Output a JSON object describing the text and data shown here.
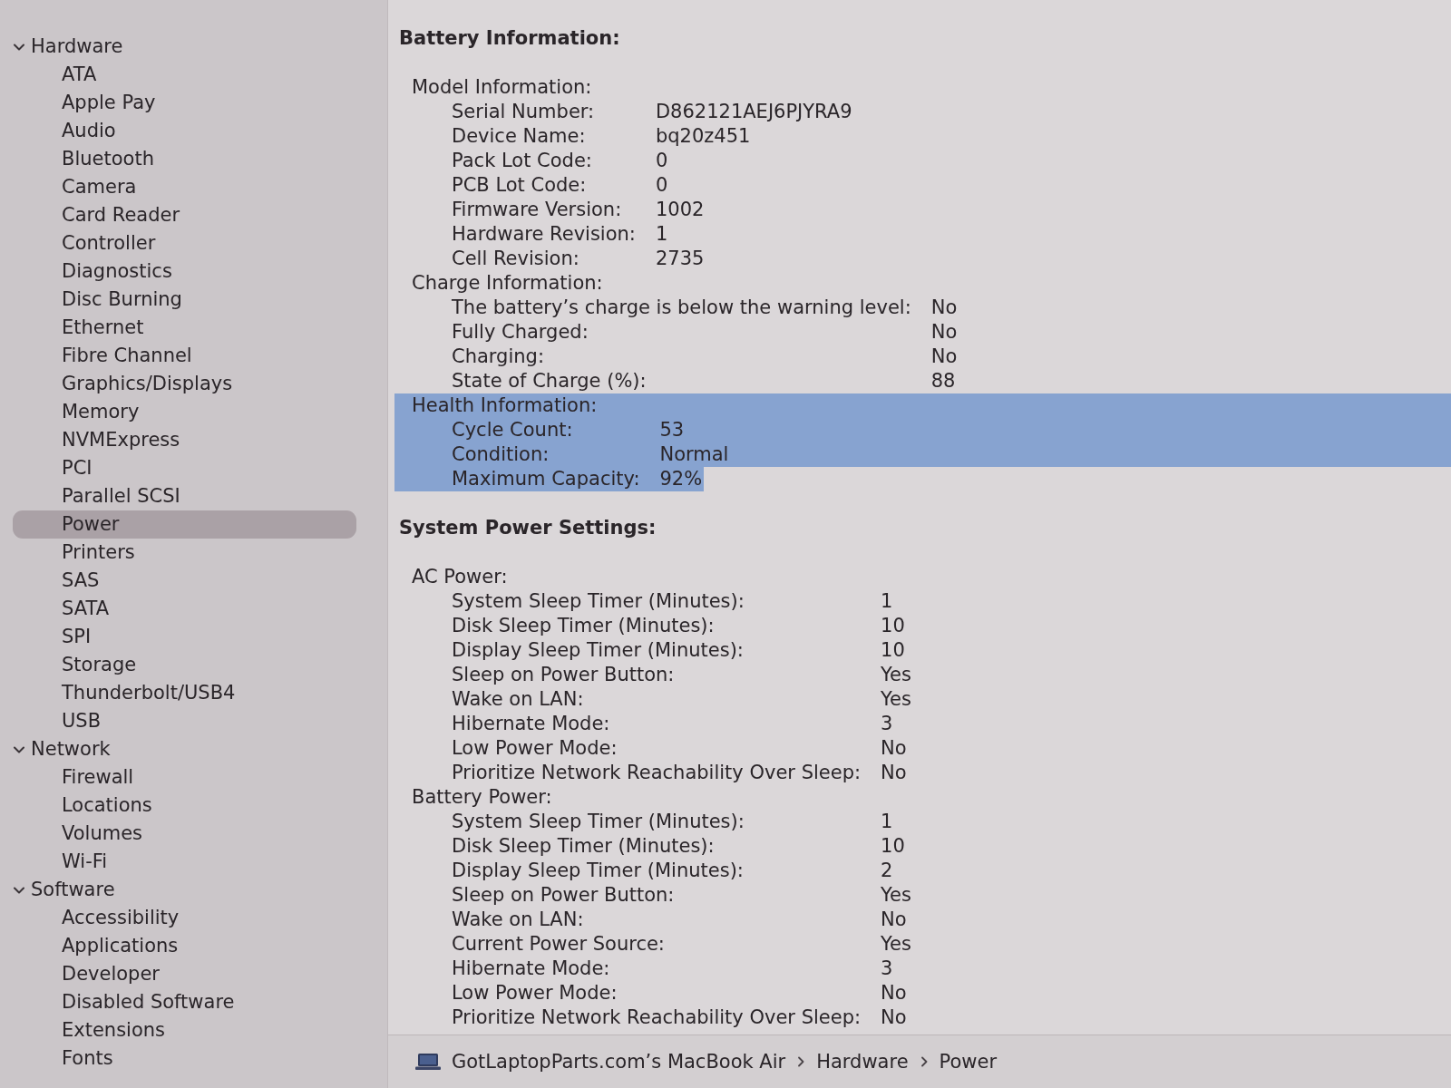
{
  "sidebar": {
    "items": [
      {
        "label": "Hardware",
        "expanded": true,
        "selected": false,
        "children": [
          {
            "label": "ATA",
            "selected": false
          },
          {
            "label": "Apple Pay",
            "selected": false
          },
          {
            "label": "Audio",
            "selected": false
          },
          {
            "label": "Bluetooth",
            "selected": false
          },
          {
            "label": "Camera",
            "selected": false
          },
          {
            "label": "Card Reader",
            "selected": false
          },
          {
            "label": "Controller",
            "selected": false
          },
          {
            "label": "Diagnostics",
            "selected": false
          },
          {
            "label": "Disc Burning",
            "selected": false
          },
          {
            "label": "Ethernet",
            "selected": false
          },
          {
            "label": "Fibre Channel",
            "selected": false
          },
          {
            "label": "Graphics/Displays",
            "selected": false
          },
          {
            "label": "Memory",
            "selected": false
          },
          {
            "label": "NVMExpress",
            "selected": false
          },
          {
            "label": "PCI",
            "selected": false
          },
          {
            "label": "Parallel SCSI",
            "selected": false
          },
          {
            "label": "Power",
            "selected": true
          },
          {
            "label": "Printers",
            "selected": false
          },
          {
            "label": "SAS",
            "selected": false
          },
          {
            "label": "SATA",
            "selected": false
          },
          {
            "label": "SPI",
            "selected": false
          },
          {
            "label": "Storage",
            "selected": false
          },
          {
            "label": "Thunderbolt/USB4",
            "selected": false
          },
          {
            "label": "USB",
            "selected": false
          }
        ]
      },
      {
        "label": "Network",
        "expanded": true,
        "selected": false,
        "children": [
          {
            "label": "Firewall",
            "selected": false
          },
          {
            "label": "Locations",
            "selected": false
          },
          {
            "label": "Volumes",
            "selected": false
          },
          {
            "label": "Wi-Fi",
            "selected": false
          }
        ]
      },
      {
        "label": "Software",
        "expanded": true,
        "selected": false,
        "children": [
          {
            "label": "Accessibility",
            "selected": false
          },
          {
            "label": "Applications",
            "selected": false
          },
          {
            "label": "Developer",
            "selected": false
          },
          {
            "label": "Disabled Software",
            "selected": false
          },
          {
            "label": "Extensions",
            "selected": false
          },
          {
            "label": "Fonts",
            "selected": false
          }
        ]
      }
    ]
  },
  "content": {
    "sections": [
      {
        "title": "Battery Information:",
        "groups": [
          {
            "title": "Model Information:",
            "selected": false,
            "rows": [
              {
                "label": "Serial Number:",
                "value": "D862121AEJ6PJYRA9",
                "selected": false
              },
              {
                "label": "Device Name:",
                "value": "bq20z451",
                "selected": false
              },
              {
                "label": "Pack Lot Code:",
                "value": "0",
                "selected": false
              },
              {
                "label": "PCB Lot Code:",
                "value": "0",
                "selected": false
              },
              {
                "label": "Firmware Version:",
                "value": "1002",
                "selected": false
              },
              {
                "label": "Hardware Revision:",
                "value": "1",
                "selected": false
              },
              {
                "label": "Cell Revision:",
                "value": "2735",
                "selected": false
              }
            ]
          },
          {
            "title": "Charge Information:",
            "selected": false,
            "rows": [
              {
                "label": "The battery’s charge is below the warning level:",
                "value": "No",
                "selected": false
              },
              {
                "label": "Fully Charged:",
                "value": "No",
                "selected": false
              },
              {
                "label": "Charging:",
                "value": "No",
                "selected": false
              },
              {
                "label": "State of Charge (%):",
                "value": "88",
                "selected": false
              }
            ]
          },
          {
            "title": "Health Information:",
            "selected": true,
            "rows": [
              {
                "label": "Cycle Count:",
                "value": "53",
                "selected": true
              },
              {
                "label": "Condition:",
                "value": "Normal",
                "selected": true
              },
              {
                "label": "Maximum Capacity:",
                "value": "92%",
                "selected": true
              }
            ]
          }
        ]
      },
      {
        "title": "System Power Settings:",
        "groups": [
          {
            "title": "AC Power:",
            "selected": false,
            "rows": [
              {
                "label": "System Sleep Timer (Minutes):",
                "value": "1",
                "selected": false
              },
              {
                "label": "Disk Sleep Timer (Minutes):",
                "value": "10",
                "selected": false
              },
              {
                "label": "Display Sleep Timer (Minutes):",
                "value": "10",
                "selected": false
              },
              {
                "label": "Sleep on Power Button:",
                "value": "Yes",
                "selected": false
              },
              {
                "label": "Wake on LAN:",
                "value": "Yes",
                "selected": false
              },
              {
                "label": "Hibernate Mode:",
                "value": "3",
                "selected": false
              },
              {
                "label": "Low Power Mode:",
                "value": "No",
                "selected": false
              },
              {
                "label": "Prioritize Network Reachability Over Sleep:",
                "value": "No",
                "selected": false
              }
            ]
          },
          {
            "title": "Battery Power:",
            "selected": false,
            "rows": [
              {
                "label": "System Sleep Timer (Minutes):",
                "value": "1",
                "selected": false
              },
              {
                "label": "Disk Sleep Timer (Minutes):",
                "value": "10",
                "selected": false
              },
              {
                "label": "Display Sleep Timer (Minutes):",
                "value": "2",
                "selected": false
              },
              {
                "label": "Sleep on Power Button:",
                "value": "Yes",
                "selected": false
              },
              {
                "label": "Wake on LAN:",
                "value": "No",
                "selected": false
              },
              {
                "label": "Current Power Source:",
                "value": "Yes",
                "selected": false
              },
              {
                "label": "Hibernate Mode:",
                "value": "3",
                "selected": false
              },
              {
                "label": "Low Power Mode:",
                "value": "No",
                "selected": false
              },
              {
                "label": "Prioritize Network Reachability Over Sleep:",
                "value": "No",
                "selected": false
              }
            ]
          }
        ]
      }
    ]
  },
  "path_bar": {
    "items": [
      "GotLaptopParts.com’s MacBook Air",
      "Hardware",
      "Power"
    ]
  }
}
